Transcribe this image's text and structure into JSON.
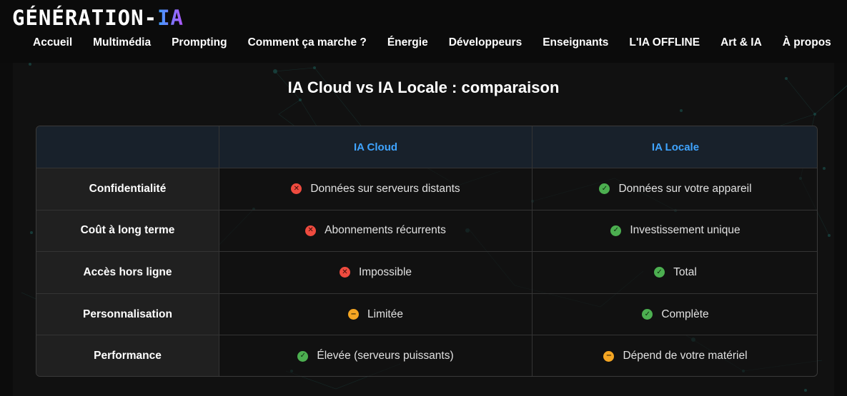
{
  "logo": {
    "main": "GÉNÉRATION-",
    "accent": "IA"
  },
  "nav": [
    "Accueil",
    "Multimédia",
    "Prompting",
    "Comment ça marche ?",
    "Énergie",
    "Développeurs",
    "Enseignants",
    "L'IA OFFLINE",
    "Art & IA",
    "À propos"
  ],
  "title": "IA Cloud vs IA Locale : comparaison",
  "table": {
    "headers": [
      "",
      "IA Cloud",
      "IA Locale"
    ],
    "rows": [
      {
        "label": "Confidentialité",
        "cloud": {
          "text": "Données sur serveurs distants",
          "status": "bad"
        },
        "local": {
          "text": "Données sur votre appareil",
          "status": "good"
        }
      },
      {
        "label": "Coût à long terme",
        "cloud": {
          "text": "Abonnements récurrents",
          "status": "bad"
        },
        "local": {
          "text": "Investissement unique",
          "status": "good"
        }
      },
      {
        "label": "Accès hors ligne",
        "cloud": {
          "text": "Impossible",
          "status": "bad"
        },
        "local": {
          "text": "Total",
          "status": "good"
        }
      },
      {
        "label": "Personnalisation",
        "cloud": {
          "text": "Limitée",
          "status": "neutral"
        },
        "local": {
          "text": "Complète",
          "status": "good"
        }
      },
      {
        "label": "Performance",
        "cloud": {
          "text": "Élevée (serveurs puissants)",
          "status": "good"
        },
        "local": {
          "text": "Dépend de votre matériel",
          "status": "neutral"
        }
      }
    ]
  },
  "icons": {
    "bad": "x-circle-icon",
    "good": "check-circle-icon",
    "neutral": "minus-circle-icon"
  },
  "colors": {
    "accent": "#3fa4ff",
    "bad": "#ef4b3f",
    "good": "#4caf50",
    "neutral": "#f5a623",
    "background": "#0c0c0c"
  }
}
